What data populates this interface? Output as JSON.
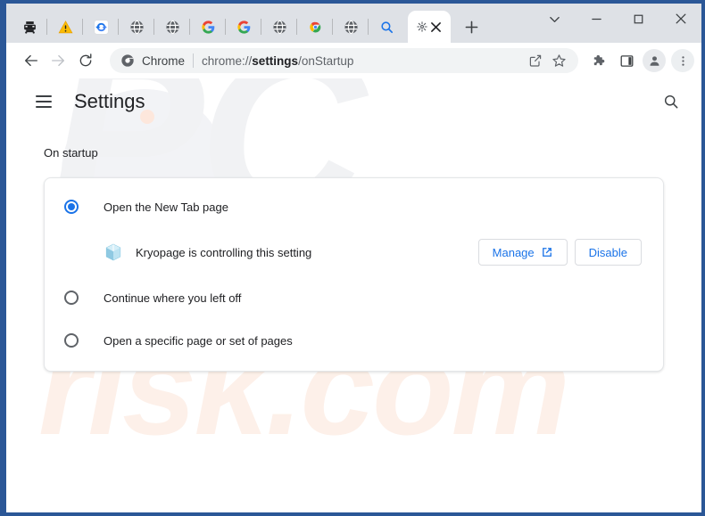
{
  "window": {
    "controls": [
      {
        "name": "tab-search-button",
        "glyph": "chevron-down"
      },
      {
        "name": "minimize-button",
        "glyph": "minimize"
      },
      {
        "name": "maximize-button",
        "glyph": "maximize"
      },
      {
        "name": "close-button",
        "glyph": "close"
      }
    ]
  },
  "tabstrip": {
    "pinned_tabs": [
      {
        "icon": "printer-icon",
        "type": "printer"
      },
      {
        "icon": "warning-triangle-icon",
        "type": "warning"
      },
      {
        "icon": "chrome-sync-refresh-icon",
        "type": "refresh"
      },
      {
        "icon": "globe-icon",
        "type": "globe"
      },
      {
        "icon": "globe-icon",
        "type": "globe"
      },
      {
        "icon": "google-g-icon",
        "type": "google"
      },
      {
        "icon": "google-g-icon",
        "type": "google"
      },
      {
        "icon": "globe-icon",
        "type": "globe"
      },
      {
        "icon": "chrome-logo-icon",
        "type": "chrome"
      },
      {
        "icon": "globe-icon",
        "type": "globe"
      },
      {
        "icon": "search-magnifier-icon",
        "type": "search"
      }
    ],
    "active_tab": {
      "favicon": "settings-gear-icon",
      "close_label": "close-tab"
    },
    "new_tab_label": "New tab"
  },
  "toolbar": {
    "back_label": "Back",
    "forward_label": "Forward",
    "reload_label": "Reload",
    "omnibox": {
      "chrome_label": "Chrome",
      "url_prefix": "chrome://",
      "url_bold": "settings",
      "url_suffix": "/onStartup",
      "full_url": "chrome://settings/onStartup"
    },
    "share_label": "Share this page",
    "bookmark_label": "Bookmark this tab",
    "extensions_label": "Extensions",
    "sidepanel_label": "Side panel",
    "profile_label": "Profile",
    "menu_label": "Customize and control Google Chrome"
  },
  "settings": {
    "menu_label": "Main menu",
    "title": "Settings",
    "search_label": "Search settings"
  },
  "on_startup": {
    "section_title": "On startup",
    "options": [
      {
        "label": "Open the New Tab page",
        "selected": true
      },
      {
        "label": "Continue where you left off",
        "selected": false
      },
      {
        "label": "Open a specific page or set of pages",
        "selected": false
      }
    ],
    "extension_notice": {
      "icon": "extension-cube-icon",
      "text": "Kryopage is controlling this setting",
      "manage_label": "Manage",
      "manage_icon": "external-link-icon",
      "disable_label": "Disable"
    }
  },
  "watermark": {
    "top_text": "PC",
    "bottom_text": "risk.com"
  },
  "colors": {
    "accent": "#1a73e8",
    "tabstrip_bg": "#dee1e6",
    "frame": "#2b5797",
    "text_primary": "#202124",
    "text_secondary": "#5f6368",
    "omnibox_bg": "#f1f3f4"
  }
}
